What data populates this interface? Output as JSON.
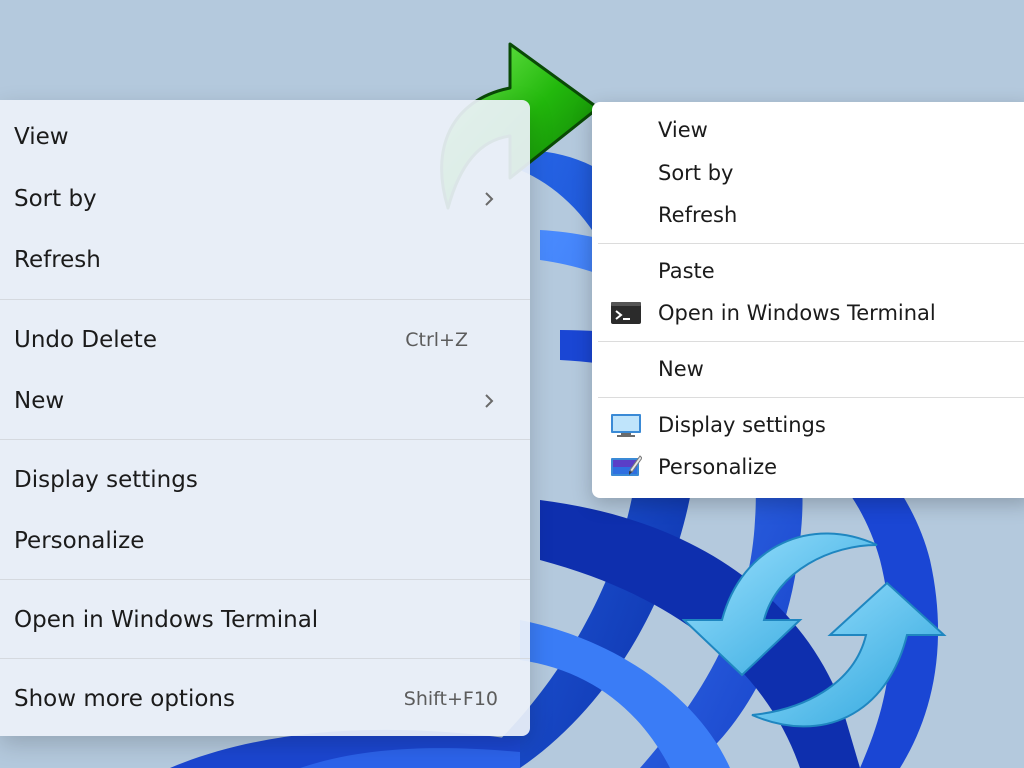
{
  "left_menu": {
    "items": [
      {
        "label": "View",
        "shortcut": "",
        "submenu": false
      },
      {
        "label": "Sort by",
        "shortcut": "",
        "submenu": true
      },
      {
        "label": "Refresh",
        "shortcut": "",
        "submenu": false
      },
      {
        "label": "Undo Delete",
        "shortcut": "Ctrl+Z",
        "submenu": false
      },
      {
        "label": "New",
        "shortcut": "",
        "submenu": true
      },
      {
        "label": "Display settings",
        "shortcut": "",
        "submenu": false
      },
      {
        "label": "Personalize",
        "shortcut": "",
        "submenu": false
      },
      {
        "label": "Open in Windows Terminal",
        "shortcut": "",
        "submenu": false
      },
      {
        "label": "Show more options",
        "shortcut": "Shift+F10",
        "submenu": false
      }
    ]
  },
  "right_menu": {
    "items": [
      {
        "label": "View",
        "icon": ""
      },
      {
        "label": "Sort by",
        "icon": ""
      },
      {
        "label": "Refresh",
        "icon": ""
      },
      {
        "label": "Paste",
        "icon": ""
      },
      {
        "label": "Open in Windows Terminal",
        "icon": "terminal-icon"
      },
      {
        "label": "New",
        "icon": ""
      },
      {
        "label": "Display settings",
        "icon": "display-settings-icon"
      },
      {
        "label": "Personalize",
        "icon": "personalize-icon"
      }
    ]
  },
  "decorations": {
    "forward_arrow": "green-curved-arrow-icon",
    "refresh_arrows": "blue-circular-arrows-icon"
  },
  "colors": {
    "wallpaper_sky": "#b9cde0",
    "wallpaper_bloom": "#1e4fd8",
    "arrow_green": "#22b80c",
    "refresh_blue": "#59c4ee"
  }
}
